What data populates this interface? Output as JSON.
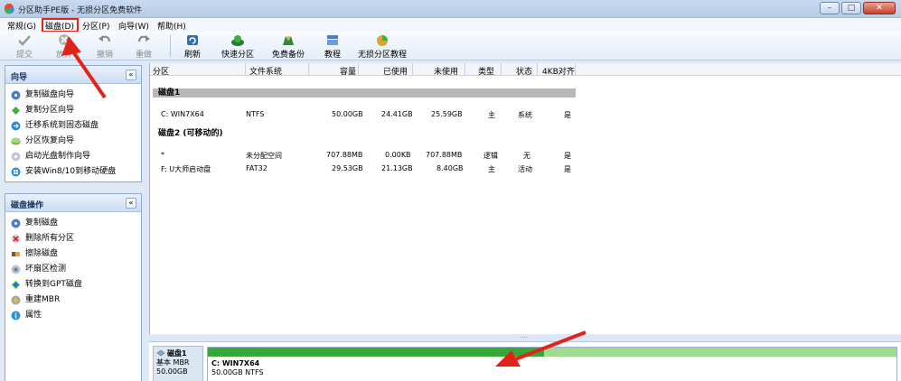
{
  "window": {
    "title": "分区助手PE版 - 无损分区免费软件",
    "buttons": {
      "minimize": "–",
      "maximize": "□",
      "close": "✕"
    }
  },
  "menu": {
    "items": [
      "常规(G)",
      "磁盘(D)",
      "分区(P)",
      "向导(W)",
      "帮助(H)"
    ],
    "highlighted": "磁盘(D)"
  },
  "toolbar": {
    "items": [
      {
        "label": "提交",
        "icon": "check-icon",
        "enabled": false
      },
      {
        "label": "放弃",
        "icon": "discard-icon",
        "enabled": false
      },
      {
        "label": "撤销",
        "icon": "undo-icon",
        "enabled": false
      },
      {
        "label": "重做",
        "icon": "redo-icon",
        "enabled": false
      },
      {
        "label": "刷新",
        "icon": "refresh-icon",
        "enabled": true
      },
      {
        "label": "快速分区",
        "icon": "quick-partition-icon",
        "enabled": true
      },
      {
        "label": "免费备份",
        "icon": "backup-icon",
        "enabled": true
      },
      {
        "label": "教程",
        "icon": "tutorial-icon",
        "enabled": true
      },
      {
        "label": "无损分区教程",
        "icon": "lossless-tutorial-icon",
        "enabled": true
      }
    ]
  },
  "sidebar": {
    "wizard": {
      "title": "向导",
      "collapse": "«",
      "items": [
        "复制磁盘向导",
        "复制分区向导",
        "迁移系统到固态磁盘",
        "分区恢复向导",
        "启动光盘制作向导",
        "安装Win8/10到移动硬盘"
      ]
    },
    "disk_ops": {
      "title": "磁盘操作",
      "collapse": "«",
      "items": [
        "复制磁盘",
        "删除所有分区",
        "擦除磁盘",
        "坏扇区检测",
        "转换到GPT磁盘",
        "重建MBR",
        "属性"
      ]
    }
  },
  "table": {
    "columns": [
      "分区",
      "文件系统",
      "容量",
      "已使用",
      "未使用",
      "类型",
      "状态",
      "4KB对齐"
    ],
    "disks": [
      {
        "title": "磁盘1",
        "rows": [
          {
            "partition": "C: WIN7X64",
            "fs": "NTFS",
            "capacity": "50.00GB",
            "used": "24.41GB",
            "free": "25.59GB",
            "type": "主",
            "status": "系统",
            "aligned": "是"
          }
        ]
      },
      {
        "title": "磁盘2 (可移动的)",
        "rows": [
          {
            "partition": "*",
            "fs": "未分配空间",
            "capacity": "707.88MB",
            "used": "0.00KB",
            "free": "707.88MB",
            "type": "逻辑",
            "status": "无",
            "aligned": "是"
          },
          {
            "partition": "F: U大师启动盘",
            "fs": "FAT32",
            "capacity": "29.53GB",
            "used": "21.13GB",
            "free": "8.40GB",
            "type": "主",
            "status": "活动",
            "aligned": "是"
          }
        ]
      }
    ]
  },
  "disk_map": {
    "name": "磁盘1",
    "kind": "基本 MBR",
    "size": "50.00GB",
    "partition_name": "C: WIN7X64",
    "partition_info": "50.00GB NTFS",
    "used_fraction": 0.488,
    "splitter_grip": "....",
    "colors": {
      "used": "#36a839",
      "free": "#9fdc8f"
    }
  },
  "annotations": {
    "color": "#e2231a"
  }
}
